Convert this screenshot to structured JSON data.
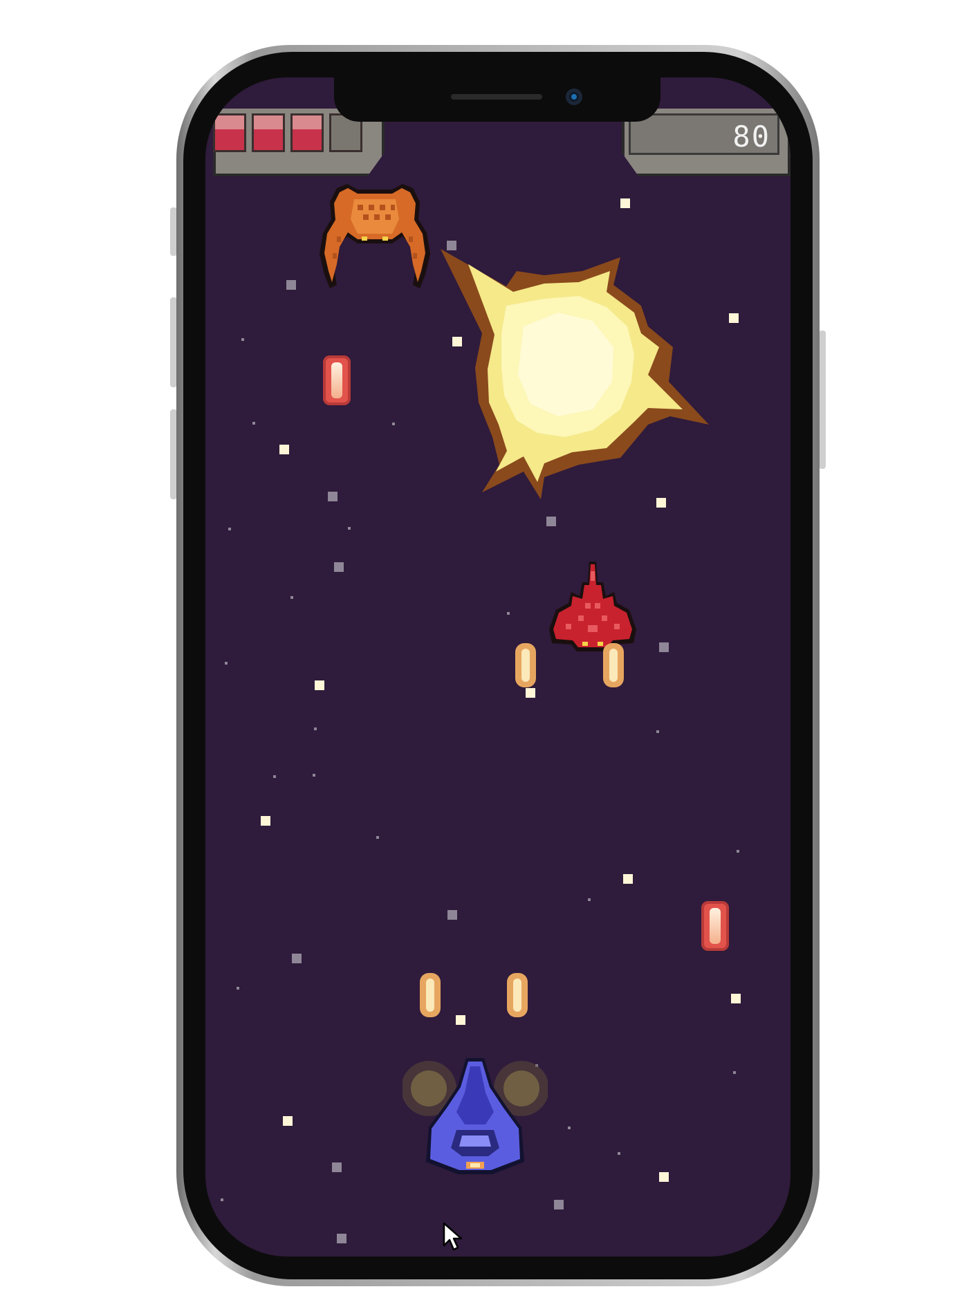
{
  "hud": {
    "health_cells": [
      "full",
      "full",
      "full",
      "empty"
    ],
    "health_filled": 3,
    "health_max": 4,
    "score": "80"
  },
  "sprites": {
    "enemies": [
      "orange-crab-enemy",
      "red-fighter-enemy"
    ],
    "effects": [
      "explosion"
    ],
    "player": "blue-player-ship",
    "projectiles": {
      "enemy_bullets": 2,
      "player_bullets": 4
    }
  },
  "colors": {
    "space_background": "#2f1b3b",
    "health_full": "#c8324a",
    "health_empty": "#7a7771",
    "hud_panel": "#8a8680",
    "score_text": "#f2f2f2",
    "explosion_core": "#fdf7b8",
    "explosion_edge": "#8a4a1c",
    "player_ship": "#5b5de0",
    "enemy_red": "#c8222e",
    "enemy_orange": "#d66a26"
  },
  "icons": {
    "cursor": "pointer-cursor-icon"
  }
}
